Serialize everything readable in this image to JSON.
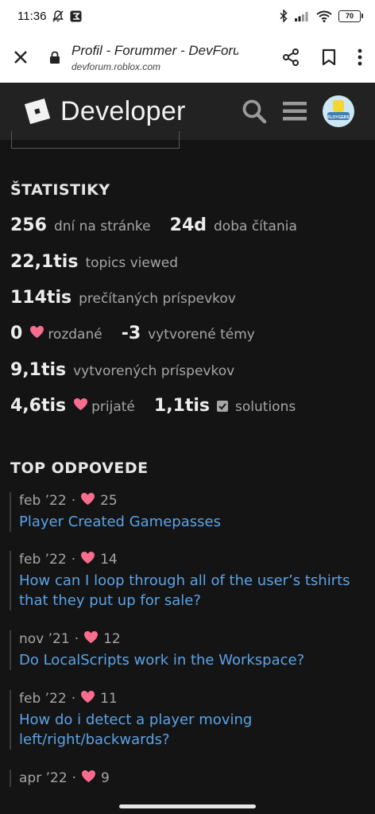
{
  "status_bar": {
    "time": "11:36",
    "battery": "70"
  },
  "browser": {
    "page_title": "Profil - Forummer - DevForu...",
    "host": "devforum.roblox.com"
  },
  "site": {
    "logo_text": "Developer",
    "avatar_label": "FLOYGERS"
  },
  "stats": {
    "title": "ŠTATISTIKY",
    "rows": [
      [
        {
          "value": "256",
          "label": "dní na stránke"
        },
        {
          "value": "24d",
          "label": "doba čítania"
        }
      ],
      [
        {
          "value": "22,1tis",
          "label": "topics viewed"
        }
      ],
      [
        {
          "value": "114tis",
          "label": "prečítaných príspevkov"
        }
      ],
      [
        {
          "value": "0",
          "label": "rozdané"
        },
        {
          "value": "-3",
          "label": "vytvorené témy"
        }
      ],
      [
        {
          "value": "9,1tis",
          "label": "vytvorených príspevkov"
        }
      ],
      [
        {
          "value": "4,6tis",
          "label": "prijaté"
        },
        {
          "value": "1,1tis",
          "label": "solutions"
        }
      ]
    ]
  },
  "top_replies": {
    "title": "TOP ODPOVEDE",
    "items": [
      {
        "date": "feb ’22",
        "sep": "·",
        "likes": "25",
        "title": "Player Created Gamepasses"
      },
      {
        "date": "feb ’22",
        "sep": "·",
        "likes": "14",
        "title": "How can I loop through all of the user’s tshirts that they put up for sale?"
      },
      {
        "date": "nov ’21",
        "sep": "·",
        "likes": "12",
        "title": "Do LocalScripts work in the Workspace?"
      },
      {
        "date": "feb ’22",
        "sep": "·",
        "likes": "11",
        "title": "How do i detect a player moving left/right/backwards?"
      },
      {
        "date": "apr ’22",
        "sep": "·",
        "likes": "9",
        "title": ""
      }
    ]
  },
  "colors": {
    "accent_link": "#5aa3e8",
    "heart": "#fa6c8d",
    "header_bg": "#222222",
    "page_bg": "#141414"
  }
}
